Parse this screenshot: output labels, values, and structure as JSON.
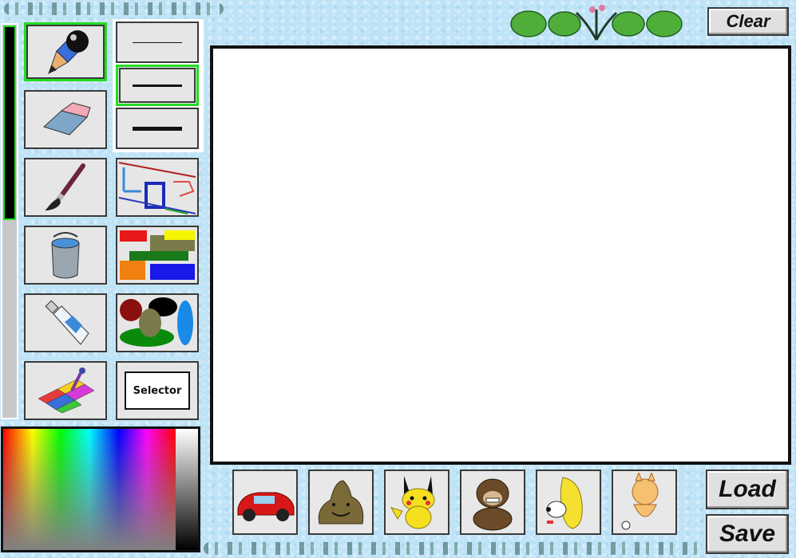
{
  "header": {
    "clear_label": "Clear"
  },
  "tools": [
    {
      "name": "pencil",
      "icon": "pencil-icon",
      "selected": true
    },
    {
      "name": "eraser",
      "icon": "eraser-icon"
    },
    {
      "name": "brush",
      "icon": "paintbrush-icon"
    },
    {
      "name": "fill",
      "icon": "paint-bucket-icon"
    },
    {
      "name": "spray",
      "icon": "spray-can-icon"
    },
    {
      "name": "color-picker",
      "icon": "eyedropper-palette-icon"
    }
  ],
  "shape_tools": [
    {
      "name": "line",
      "icon": "line-shapes-icon"
    },
    {
      "name": "rectangle",
      "icon": "rectangle-shapes-icon"
    },
    {
      "name": "ellipse",
      "icon": "ellipse-shapes-icon"
    },
    {
      "name": "selector",
      "label": "Selector"
    }
  ],
  "line_widths": [
    {
      "name": "thin",
      "selected": false
    },
    {
      "name": "medium",
      "selected": true
    },
    {
      "name": "thick",
      "selected": false
    }
  ],
  "brush_size_level": 0.5,
  "stickers": [
    {
      "name": "race-car",
      "icon": "race-car-icon"
    },
    {
      "name": "blob",
      "icon": "smiling-blob-icon"
    },
    {
      "name": "pikachu",
      "icon": "yellow-creature-icon"
    },
    {
      "name": "monkey",
      "icon": "monkey-icon"
    },
    {
      "name": "banana-dog",
      "icon": "banana-dog-icon"
    },
    {
      "name": "orange-creature",
      "icon": "orange-creature-icon"
    }
  ],
  "footer": {
    "load_label": "Load",
    "save_label": "Save"
  },
  "colors": {
    "selected_highlight": "#22dd22",
    "canvas": "#ffffff",
    "background": "#bfe3f6"
  }
}
